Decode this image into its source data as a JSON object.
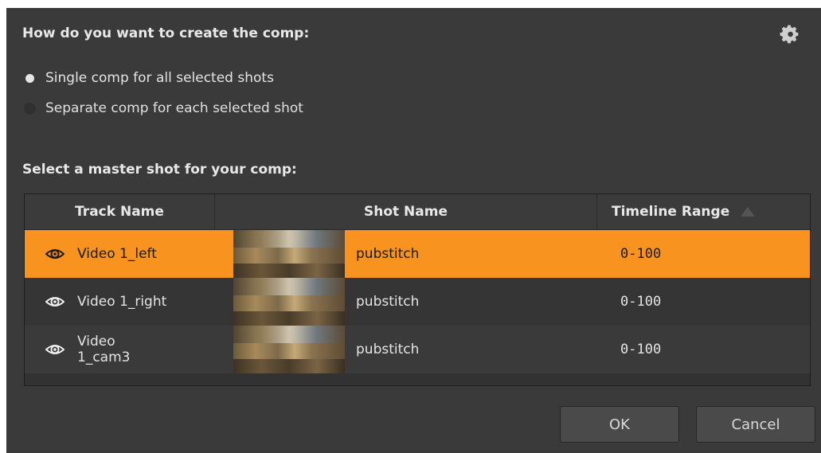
{
  "dialog": {
    "question": "How do you want to create the comp:",
    "options": [
      {
        "label": "Single comp for all selected shots",
        "selected": true
      },
      {
        "label": "Separate comp for each selected shot",
        "selected": false
      }
    ],
    "master_heading": "Select a master shot for your comp:",
    "settings_icon": "gear-icon"
  },
  "table": {
    "headers": [
      "Track Name",
      "Shot Name",
      "Timeline Range"
    ],
    "rows": [
      {
        "track": "Video 1_left",
        "shot": "pubstitch",
        "range": "0-100",
        "selected": true
      },
      {
        "track": "Video 1_right",
        "shot": "pubstitch",
        "range": "0-100",
        "selected": false
      },
      {
        "track_line1": "Video",
        "track_line2": "1_cam3",
        "shot": "pubstitch",
        "range": "0-100",
        "selected": false
      }
    ]
  },
  "buttons": {
    "ok": "OK",
    "cancel": "Cancel"
  },
  "colors": {
    "accent": "#f7931e",
    "background": "#3a3a3a"
  }
}
